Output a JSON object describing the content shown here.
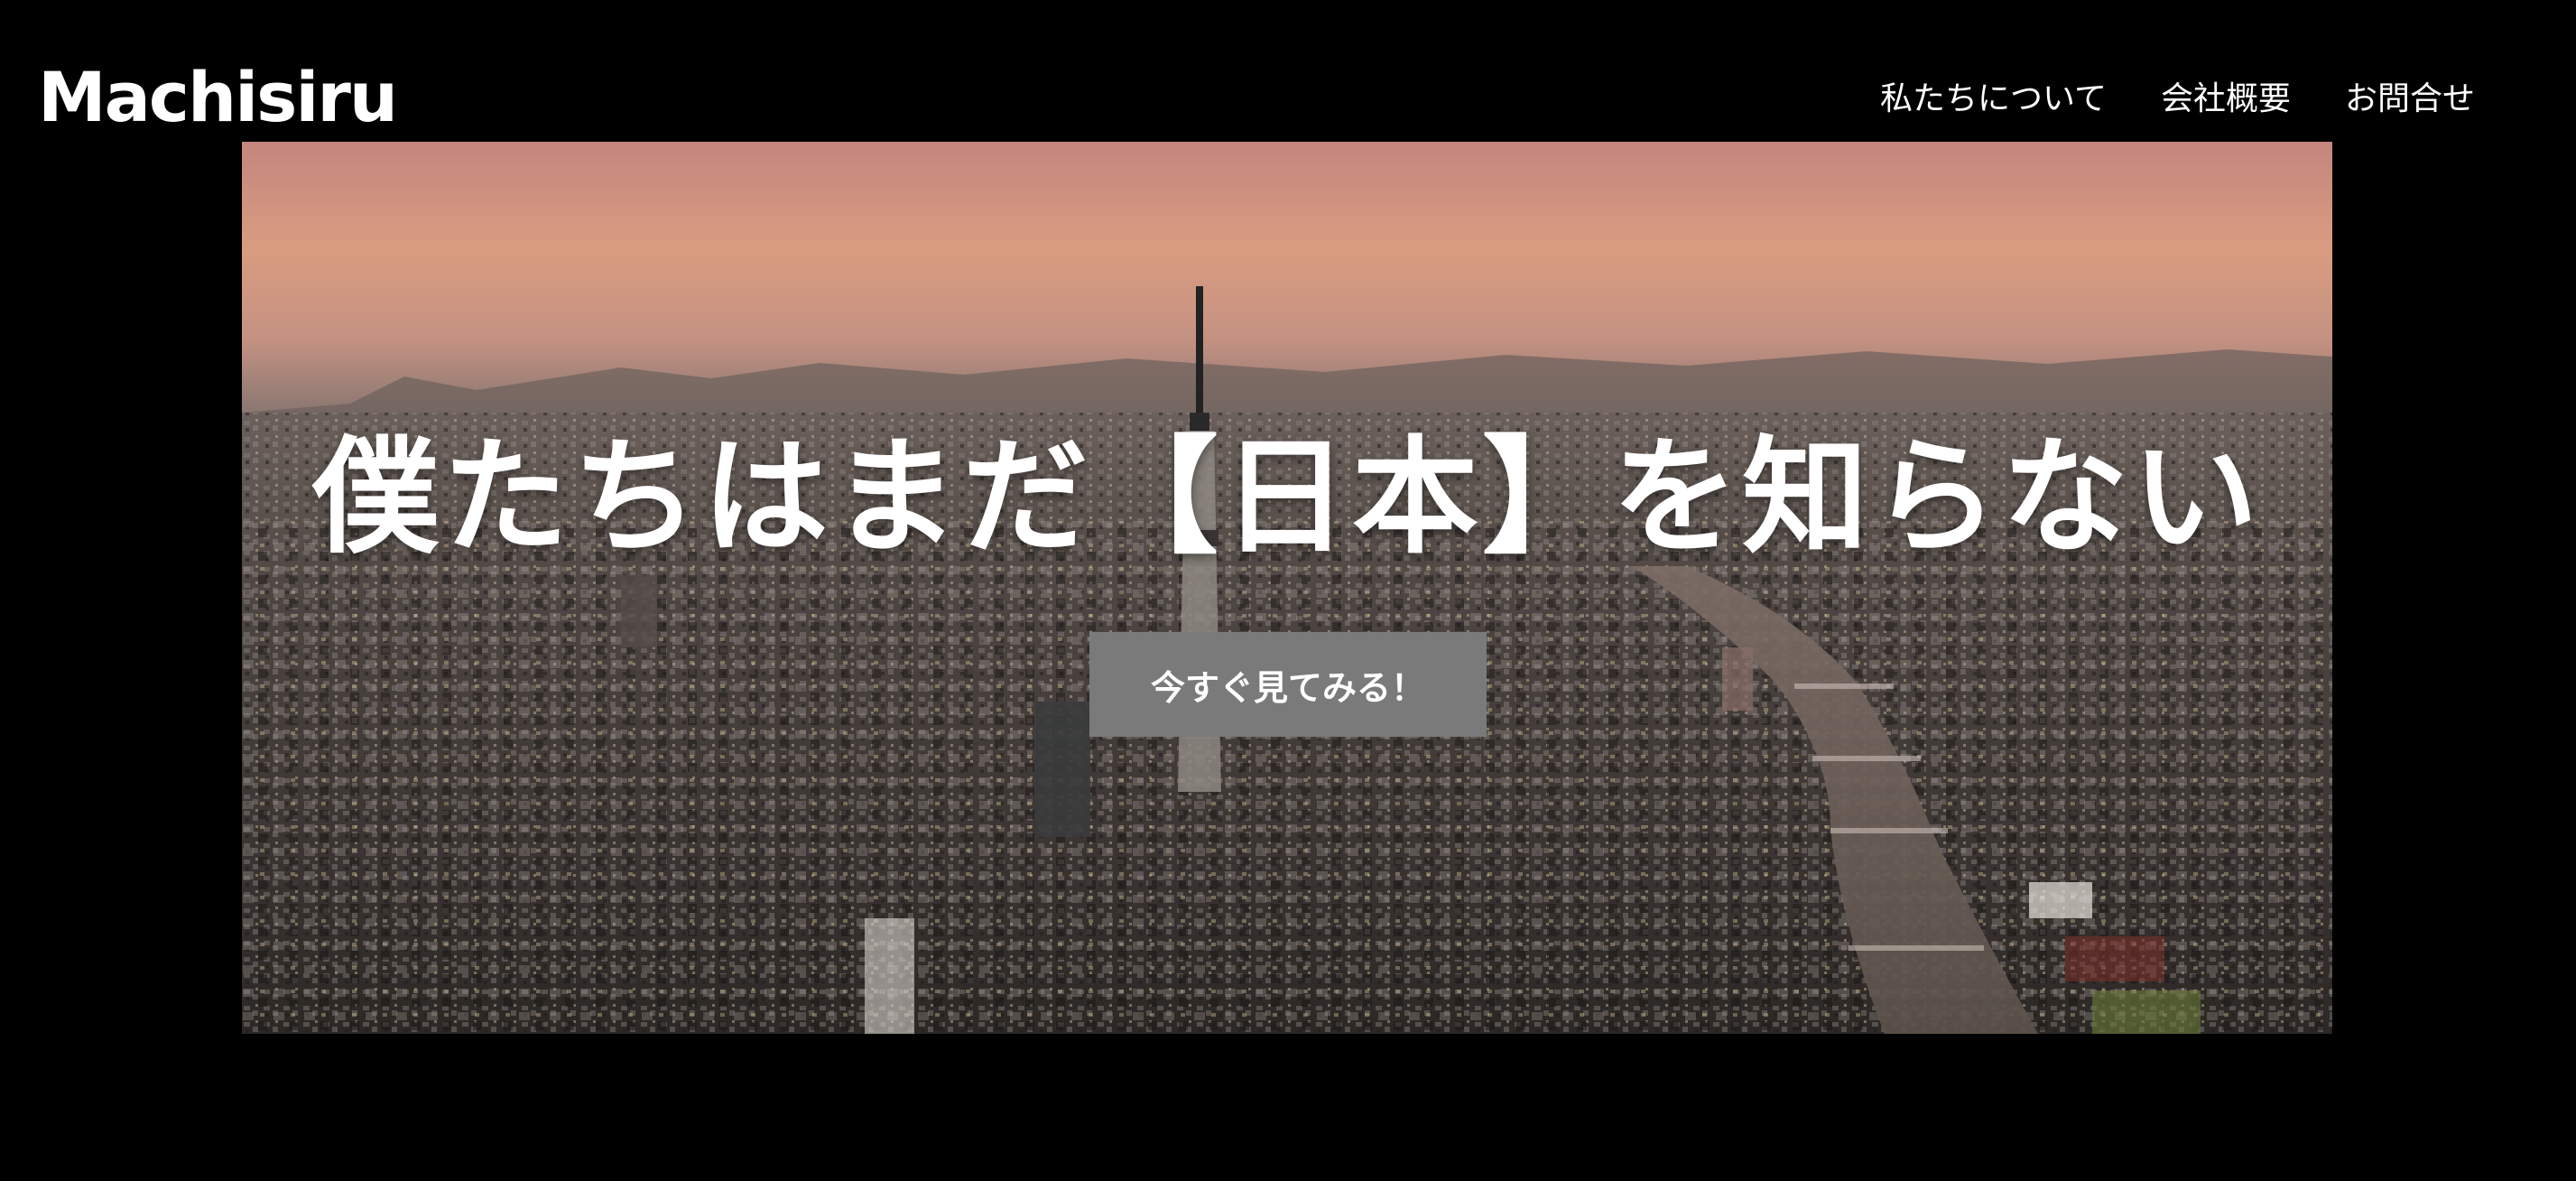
{
  "header": {
    "logo": "Machisiru",
    "nav": [
      {
        "label": "私たちについて"
      },
      {
        "label": "会社概要"
      },
      {
        "label": "お問合せ"
      }
    ]
  },
  "hero": {
    "title": "僕たちはまだ【日本】を知らない",
    "cta_label": "今すぐ見てみる！",
    "cta_color": "#7a7a7a",
    "sky_top_color": "#c98a80",
    "sky_horizon_color": "#e3a37c"
  }
}
